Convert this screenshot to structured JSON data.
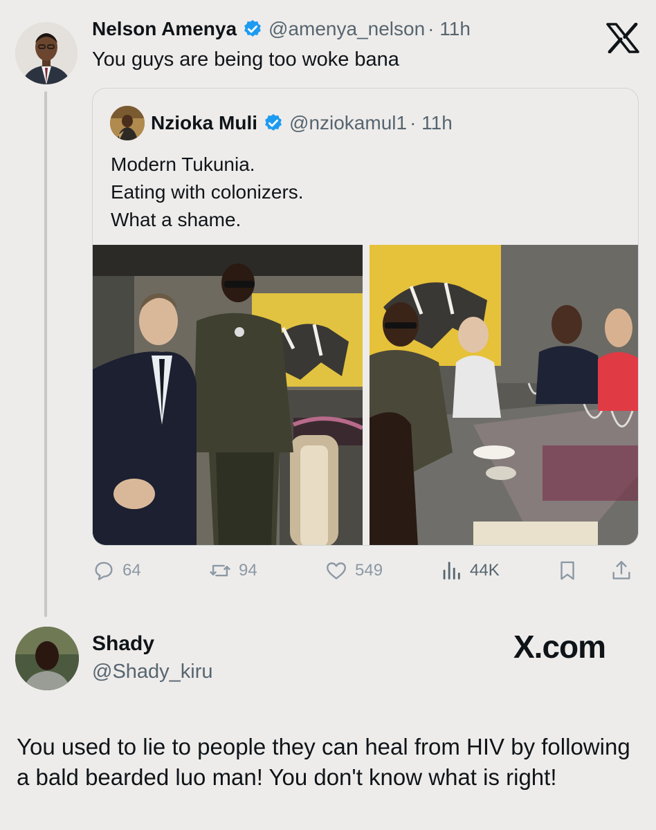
{
  "tweet": {
    "author_name": "Nelson Amenya",
    "handle": "@amenya_nelson",
    "time": "· 11h",
    "text": "You guys are being too woke bana"
  },
  "quoted_tweet": {
    "author_name": "Nzioka Muli",
    "handle": "@nziokamul1",
    "time": "· 11h",
    "lines": [
      "Modern Tukunia.",
      "Eating with colonizers.",
      "What a shame."
    ]
  },
  "actions": {
    "replies": "64",
    "reposts": "94",
    "likes": "549",
    "views": "44K"
  },
  "reply": {
    "author_name": "Shady",
    "handle": "@Shady_kiru",
    "text": "You used to lie to people they can heal from HIV by following a bald bearded luo man! You don't know what is right!"
  },
  "watermark": "X.com",
  "icons": {
    "close": "x-logo-icon",
    "verified": "verified-badge-icon",
    "reply": "comment-icon",
    "repost": "repost-icon",
    "like": "heart-icon",
    "views": "views-icon",
    "bookmark": "bookmark-icon",
    "share": "share-icon"
  },
  "colors": {
    "background": "#eeecea",
    "verified": "#1d9bf0",
    "muted": "#566570",
    "action_gray": "#8b98a5"
  }
}
